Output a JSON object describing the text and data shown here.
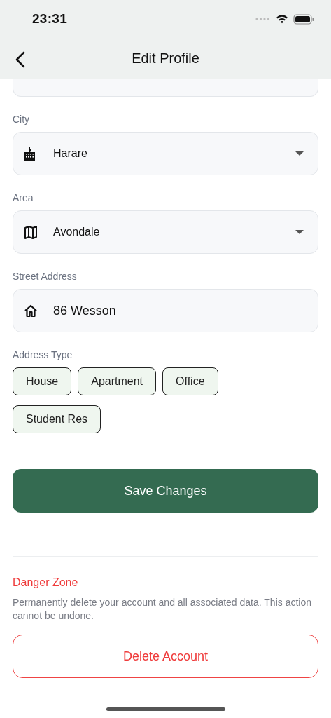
{
  "status_bar": {
    "time": "23:31"
  },
  "header": {
    "title": "Edit Profile"
  },
  "fields": [
    {
      "label": "City",
      "kind": "select",
      "value": "Harare"
    },
    {
      "label": "Area",
      "kind": "select",
      "value": "Avondale"
    },
    {
      "label": "Street Address",
      "kind": "input",
      "value": "86 Wesson"
    }
  ],
  "address_type": {
    "label": "Address Type",
    "options": [
      {
        "label": "House",
        "selected": false
      },
      {
        "label": "Apartment",
        "selected": false
      },
      {
        "label": "Office",
        "selected": false
      },
      {
        "label": "Student Res",
        "selected": false
      }
    ]
  },
  "save_button": "Save Changes",
  "danger_zone": {
    "title": "Danger Zone",
    "description": "Permanently delete your account and all associated data. This action cannot be undone.",
    "button": "Delete Account"
  }
}
